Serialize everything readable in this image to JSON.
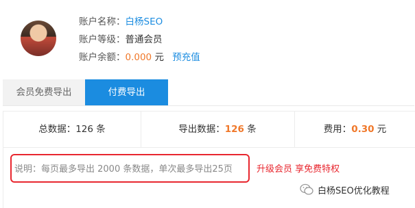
{
  "account": {
    "name_label": "账户名称：",
    "name_value": "白杨SEO",
    "level_label": "账户等级：",
    "level_value": "普通会员",
    "balance_label": "账户余额：",
    "balance_value": "0.000",
    "balance_unit": "元",
    "recharge_link": "预充值",
    "avatar_icon": "user-avatar"
  },
  "tabs": [
    {
      "label": "会员免费导出",
      "active": false
    },
    {
      "label": "付费导出",
      "active": true
    }
  ],
  "stats": {
    "total_label": "总数据：",
    "total_value": "126",
    "total_unit": "条",
    "export_label": "导出数据：",
    "export_value": "126",
    "export_unit": "条",
    "fee_label": "费用：",
    "fee_value": "0.30",
    "fee_unit": "元"
  },
  "note": {
    "text": "说明：每页最多导出 2000 条数据，单次最多导出25页",
    "upgrade_link": "升级会员 享免费特权",
    "highlight_color": "#e8262e"
  },
  "watermark": {
    "text": "白杨SEO优化教程",
    "icon": "wechat-icon"
  },
  "colors": {
    "accent_blue": "#1b8ce0",
    "accent_orange": "#f0782a",
    "alert_red": "#e8262e"
  }
}
